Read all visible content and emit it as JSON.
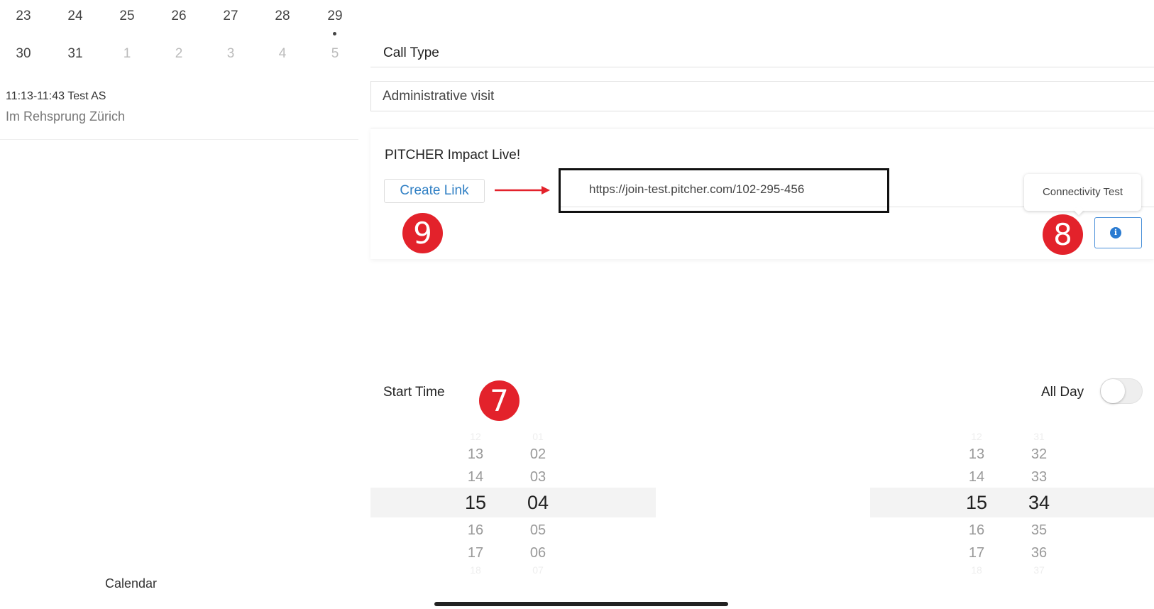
{
  "calendar": {
    "week1": [
      {
        "day": "23",
        "dim": false
      },
      {
        "day": "24",
        "dim": false
      },
      {
        "day": "25",
        "dim": false
      },
      {
        "day": "26",
        "dim": false
      },
      {
        "day": "27",
        "dim": false
      },
      {
        "day": "28",
        "dim": false
      },
      {
        "day": "29",
        "dim": false
      }
    ],
    "week2": [
      {
        "day": "30",
        "dim": false
      },
      {
        "day": "31",
        "dim": false
      },
      {
        "day": "1",
        "dim": true
      },
      {
        "day": "2",
        "dim": true
      },
      {
        "day": "3",
        "dim": true
      },
      {
        "day": "4",
        "dim": true
      },
      {
        "day": "5",
        "dim": true
      }
    ],
    "event": {
      "time": "11:13-11:43 Test AS",
      "place": "Im Rehsprung Zürich"
    },
    "footer_label": "Calendar"
  },
  "call_type": {
    "label": "Call Type",
    "value": "Administrative visit"
  },
  "pitcher": {
    "title": "PITCHER Impact Live!",
    "create_link_label": "Create Link",
    "url": "https://join-test.pitcher.com/102-295-456",
    "tooltip": "Connectivity Test",
    "info_icon": "i"
  },
  "annotations": {
    "badge_9": "9",
    "badge_8": "8",
    "badge_7": "7"
  },
  "start_time": {
    "label": "Start Time",
    "all_day_label": "All Day",
    "all_day_on": false,
    "picker_left": {
      "hours": [
        "12",
        "13",
        "14",
        "15",
        "16",
        "17",
        "18"
      ],
      "minutes": [
        "01",
        "02",
        "03",
        "04",
        "05",
        "06",
        "07"
      ]
    },
    "picker_right": {
      "hours": [
        "12",
        "13",
        "14",
        "15",
        "16",
        "17",
        "18"
      ],
      "minutes": [
        "31",
        "32",
        "33",
        "34",
        "35",
        "36",
        "37"
      ]
    }
  },
  "colors": {
    "accent": "#2f7fc4",
    "badge": "#e3222b",
    "arrow": "#e3222b"
  }
}
